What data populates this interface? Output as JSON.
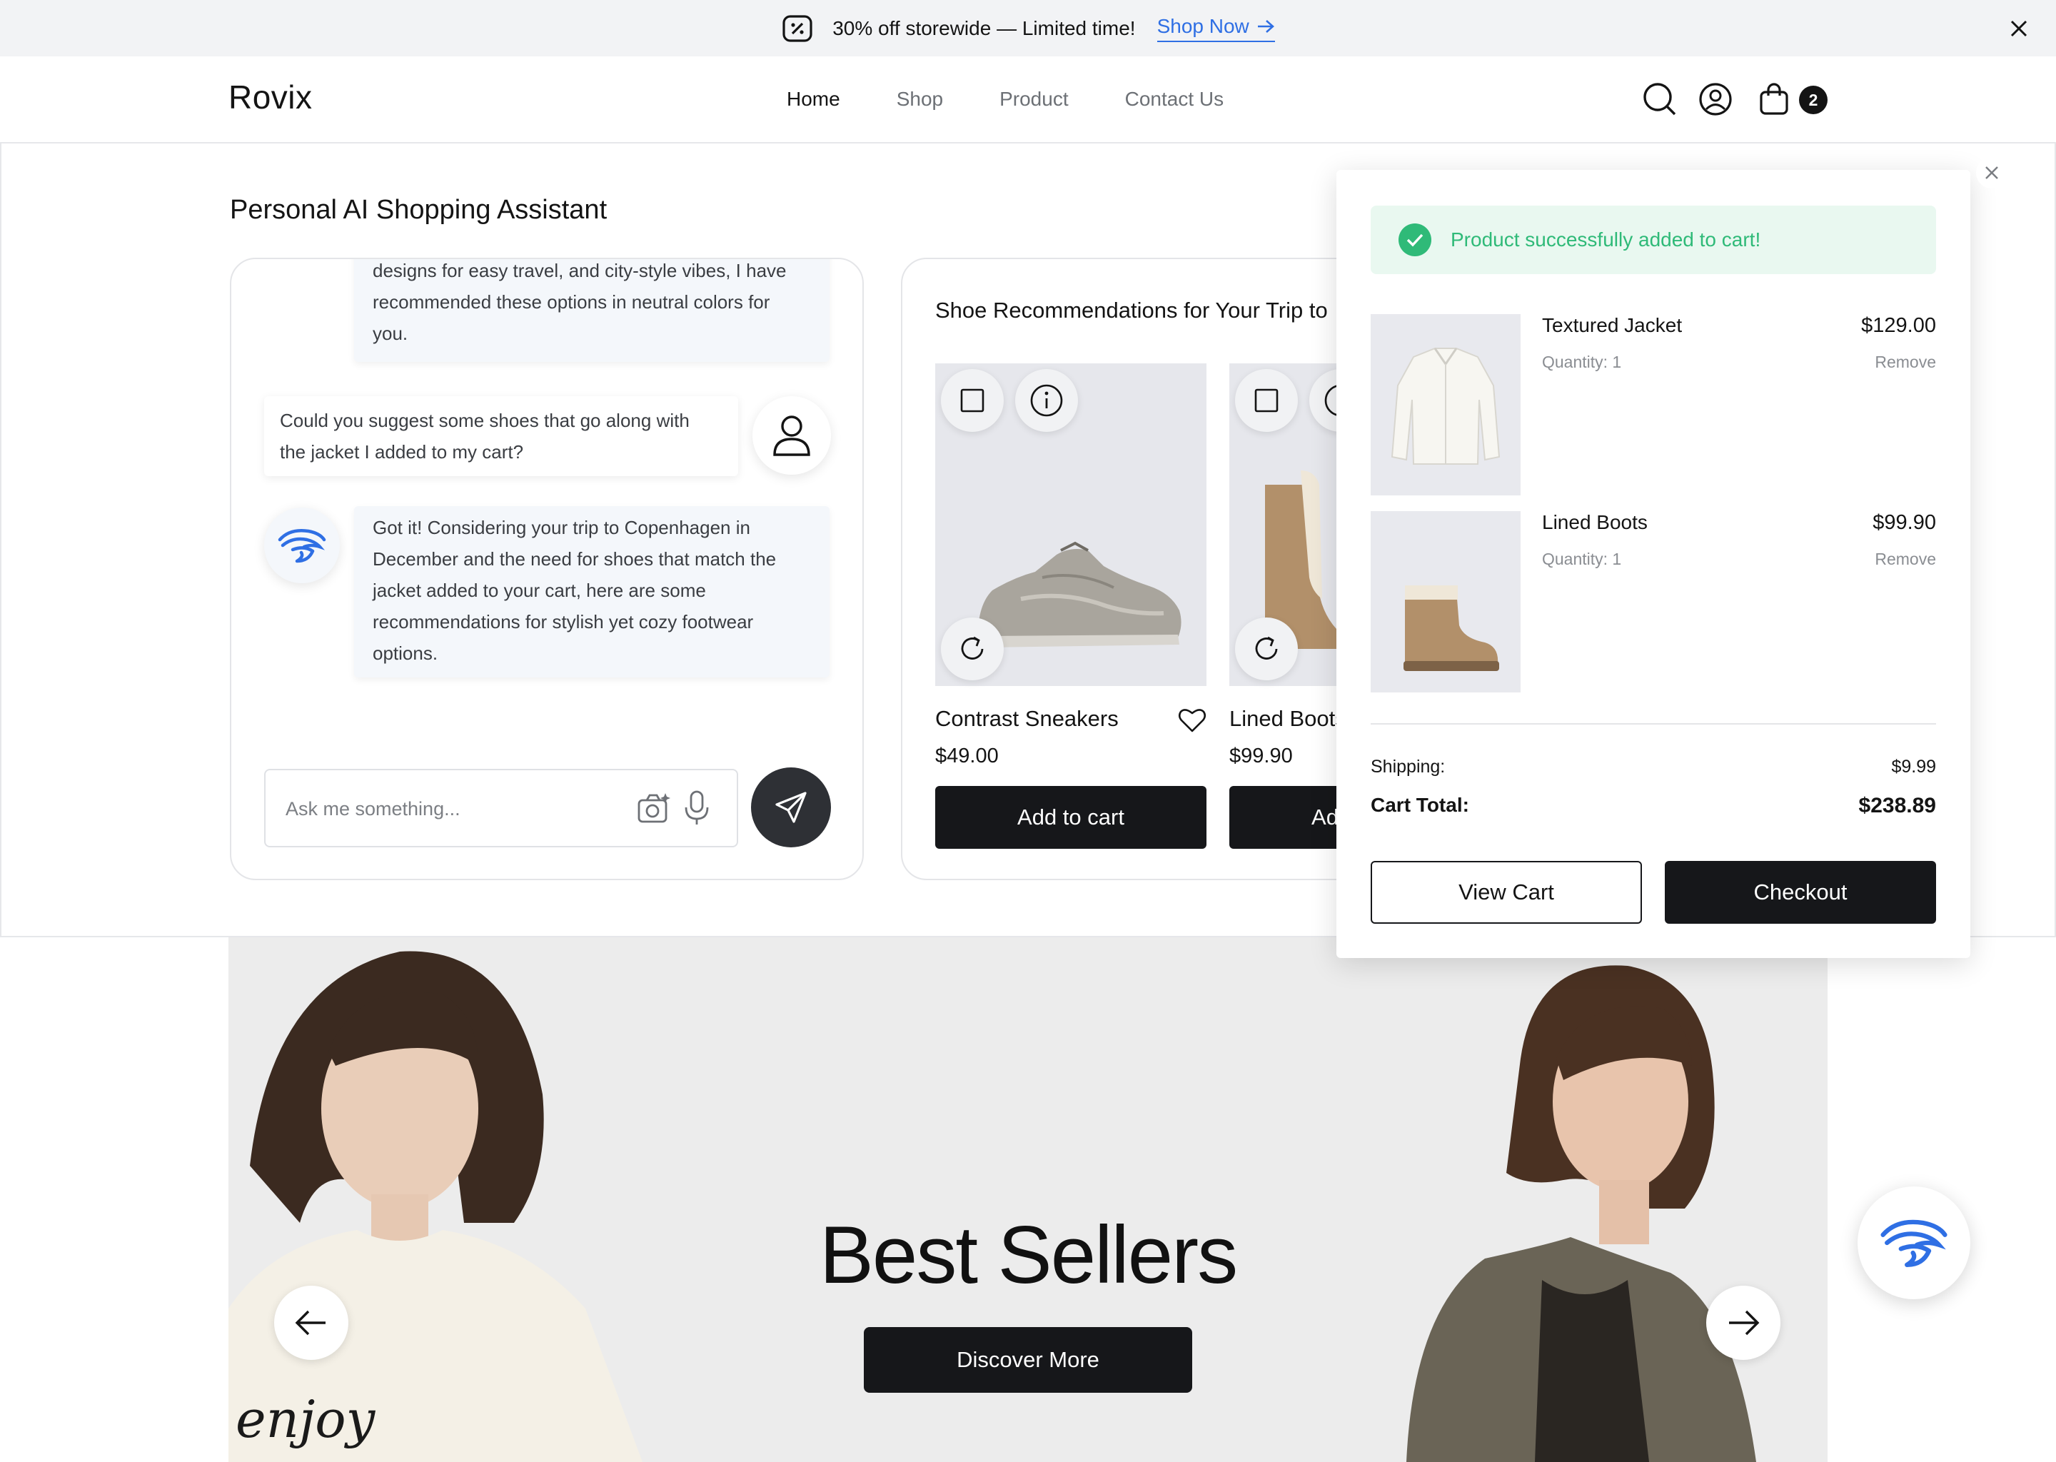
{
  "promo": {
    "text": "30% off storewide — Limited time!",
    "link_label": "Shop Now",
    "icon": "discount-tag-icon"
  },
  "header": {
    "logo": "Rovix",
    "nav": [
      {
        "label": "Home",
        "active": true
      },
      {
        "label": "Shop",
        "active": false
      },
      {
        "label": "Product",
        "active": false
      },
      {
        "label": "Contact Us",
        "active": false
      }
    ],
    "cart_count": "2"
  },
  "assistant": {
    "title": "Personal AI Shopping Assistant",
    "messages": [
      {
        "role": "ai",
        "text_lines": [
          "designs for easy travel, and city-style vibes, I have",
          "recommended these options in neutral colors for",
          "you."
        ]
      },
      {
        "role": "user",
        "text_lines": [
          "Could you suggest some shoes that go along with",
          "the jacket I added to my cart?"
        ]
      },
      {
        "role": "ai",
        "text_lines": [
          "Got it! Considering your trip to Copenhagen in",
          "December and the need for shoes that match the",
          "jacket added to your cart, here are some",
          "recommendations for stylish yet cozy footwear",
          "options."
        ]
      }
    ],
    "input_placeholder": "Ask me something..."
  },
  "recommendations": {
    "title": "Shoe Recommendations for Your Trip to",
    "products": [
      {
        "name": "Contrast Sneakers",
        "price": "$49.00",
        "button": "Add to cart"
      },
      {
        "name": "Lined Boots",
        "price": "$99.90",
        "button": "Add to cart"
      }
    ]
  },
  "cart": {
    "toast": "Product successfully added to cart!",
    "items": [
      {
        "name": "Textured Jacket",
        "quantity": "Quantity: 1",
        "price": "$129.00",
        "remove": "Remove"
      },
      {
        "name": "Lined Boots",
        "quantity": "Quantity: 1",
        "price": "$99.90",
        "remove": "Remove"
      }
    ],
    "shipping_label": "Shipping:",
    "shipping_value": "$9.99",
    "total_label": "Cart Total:",
    "total_value": "$238.89",
    "view_cart": "View Cart",
    "checkout": "Checkout"
  },
  "hero": {
    "title": "Best Sellers",
    "button": "Discover More"
  },
  "colors": {
    "accent_blue": "#2f6fe4",
    "success_green": "#2fba78",
    "dark": "#16171a"
  }
}
